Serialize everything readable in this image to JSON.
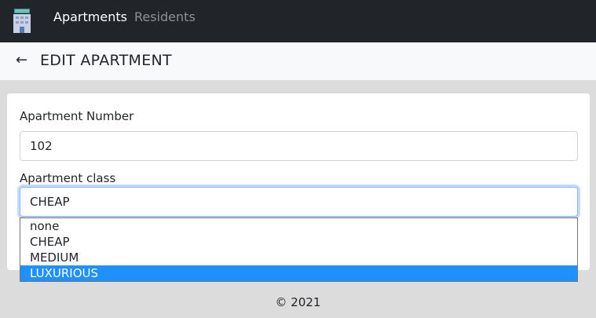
{
  "navbar": {
    "logo_icon": "hotel-building-icon",
    "links": [
      {
        "label": "Apartments",
        "active": true
      },
      {
        "label": "Residents",
        "active": false
      }
    ]
  },
  "header": {
    "back_icon": "arrow-left-icon",
    "back_glyph": "←",
    "title": "EDIT APARTMENT"
  },
  "form": {
    "apartment_number": {
      "label": "Apartment Number",
      "value": "102"
    },
    "apartment_class": {
      "label": "Apartment class",
      "selected": "CHEAP",
      "options": [
        "none",
        "CHEAP",
        "MEDIUM",
        "LUXURIOUS"
      ],
      "highlighted": "LUXURIOUS"
    }
  },
  "footer": {
    "text": "© 2021"
  },
  "colors": {
    "navbar_bg": "#212529",
    "highlight": "#1e90ff",
    "focus_border": "#86b7fe"
  }
}
